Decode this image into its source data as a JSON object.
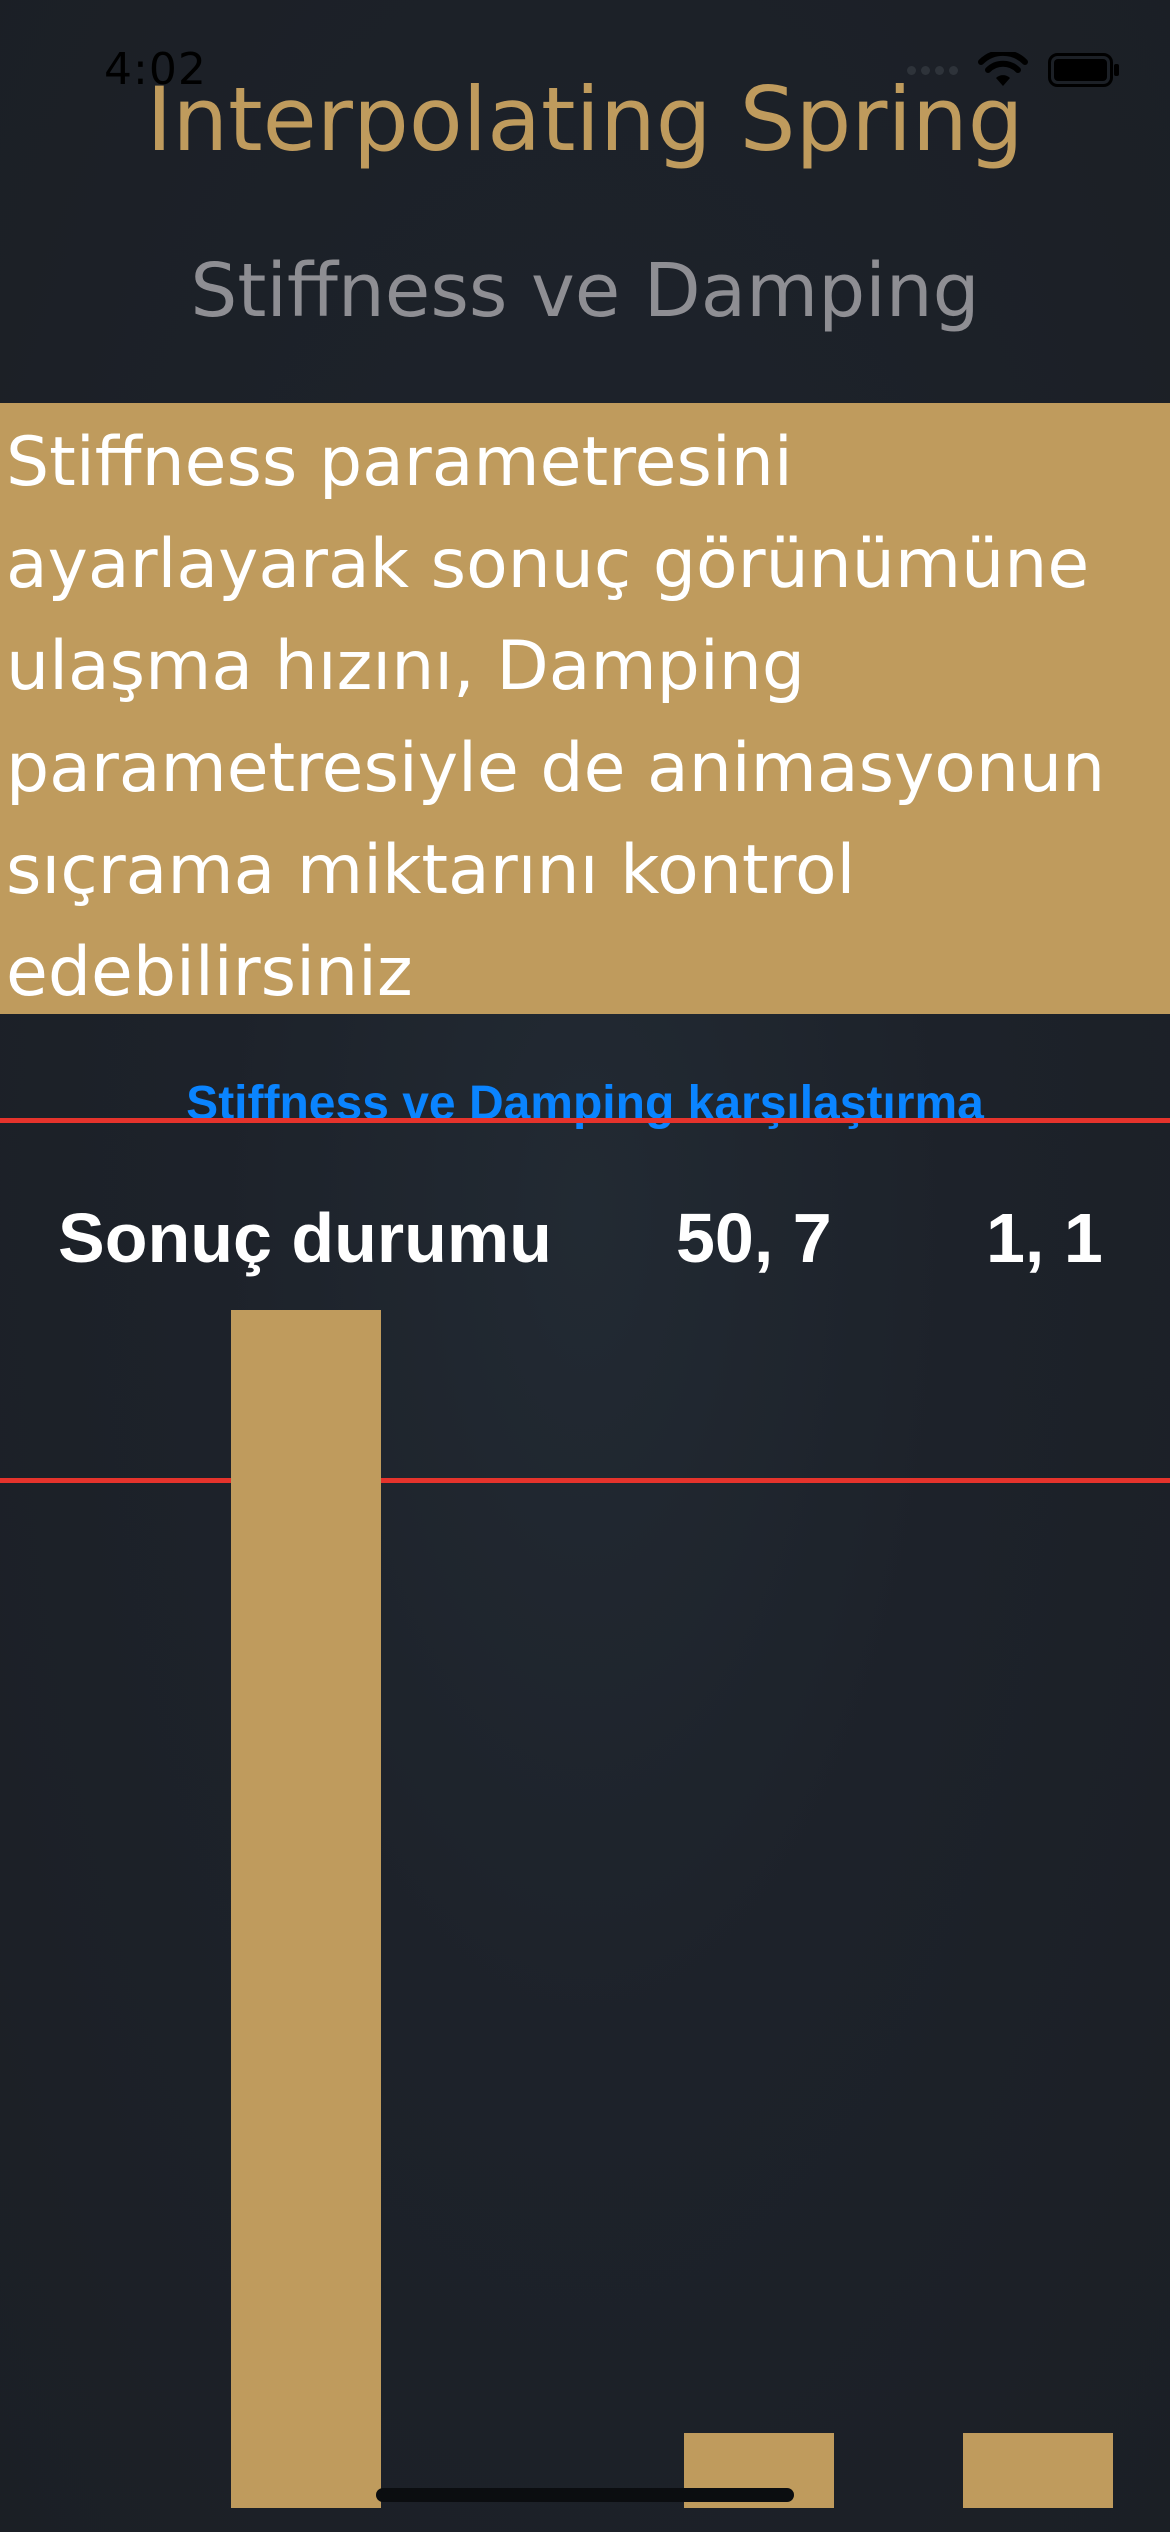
{
  "status_bar": {
    "time": "4:02",
    "icons": [
      "cellular-signal-icon",
      "wifi-icon",
      "battery-icon"
    ]
  },
  "header": {
    "title": "Interpolating Spring",
    "subtitle": "Stiffness ve Damping"
  },
  "description": "Stiffness parametresini\nayarlayarak sonuç görünümüne\nulaşma hızını, Damping\nparametresiyle de animasyonun\nsıçrama miktarını kontrol\nedebilirsiniz",
  "compare_link": "Stiffness ve Damping karşılaştırma",
  "comparison": {
    "labels": {
      "result": "Sonuç durumu",
      "first": "50, 7",
      "second": "1, 1"
    }
  },
  "colors": {
    "accent": "#bf9b5d",
    "link": "#0a84ff",
    "guide_line": "#e5332c",
    "subtitle": "#8e8e93",
    "background": "#1d222a"
  }
}
